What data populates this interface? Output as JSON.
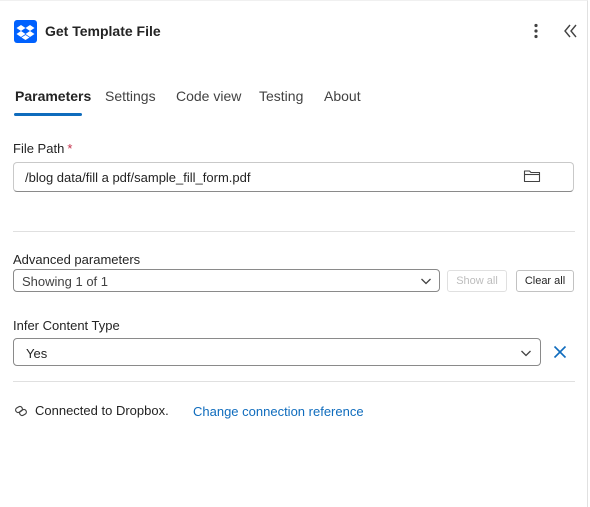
{
  "header": {
    "title": "Get Template File",
    "brand_color": "#0061fe"
  },
  "tabs": [
    {
      "label": "Parameters",
      "active": true
    },
    {
      "label": "Settings",
      "active": false
    },
    {
      "label": "Code view",
      "active": false
    },
    {
      "label": "Testing",
      "active": false
    },
    {
      "label": "About",
      "active": false
    }
  ],
  "file_path": {
    "label": "File Path",
    "required_marker": "*",
    "value": "/blog data/fill a pdf/sample_fill_form.pdf"
  },
  "advanced": {
    "label": "Advanced parameters",
    "selected": "Showing 1 of 1",
    "show_all_label": "Show all",
    "clear_all_label": "Clear all"
  },
  "infer_content_type": {
    "label": "Infer Content Type",
    "selected": "Yes"
  },
  "connection": {
    "status_text": "Connected to Dropbox.",
    "change_link": "Change connection reference"
  },
  "colors": {
    "accent": "#0f6cbd",
    "required": "#c4314b"
  }
}
